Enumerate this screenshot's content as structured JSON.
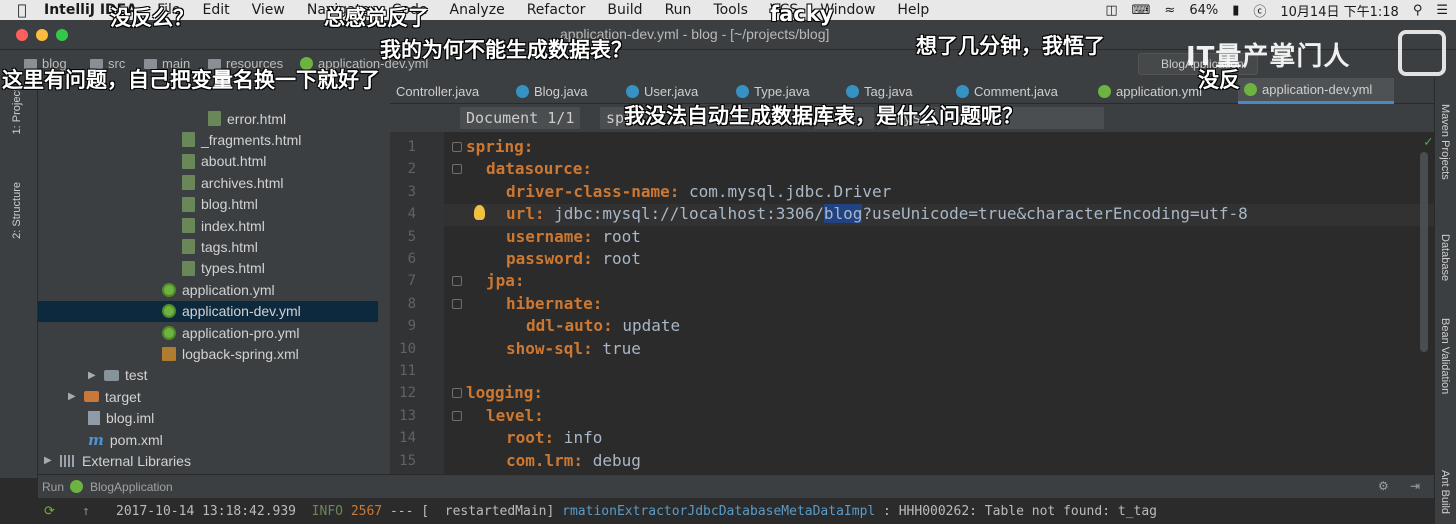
{
  "menubar": {
    "app_name": "IntelliJ IDEA",
    "items": [
      "File",
      "Edit",
      "View",
      "Navigate",
      "Code",
      "Analyze",
      "Refactor",
      "Build",
      "Run",
      "Tools",
      "VCS",
      "Window",
      "Help"
    ],
    "battery": "64%",
    "datetime": "10月14日 下午1:18"
  },
  "window": {
    "title": "application-dev.yml - blog - [~/projects/blog]",
    "colors": {
      "close": "#fc605c",
      "minimize": "#fdbc40",
      "zoom": "#34c84a"
    }
  },
  "navbar": {
    "crumbs": [
      "blog",
      "src",
      "main",
      "resources",
      "application-dev.yml"
    ],
    "run_config": "BlogApplication"
  },
  "left_strip": {
    "project_label": "1: Project",
    "structure_label": "2: Structure"
  },
  "right_strip": {
    "labels": [
      "Maven Projects",
      "Database",
      "Bean Validation",
      "Ant Build"
    ]
  },
  "project_tree": [
    {
      "name": "error.html",
      "icon": "html-file-icon"
    },
    {
      "name": "_fragments.html",
      "icon": "html-file-icon"
    },
    {
      "name": "about.html",
      "icon": "html-file-icon"
    },
    {
      "name": "archives.html",
      "icon": "html-file-icon"
    },
    {
      "name": "blog.html",
      "icon": "html-file-icon"
    },
    {
      "name": "index.html",
      "icon": "html-file-icon"
    },
    {
      "name": "tags.html",
      "icon": "html-file-icon"
    },
    {
      "name": "types.html",
      "icon": "html-file-icon"
    },
    {
      "name": "application.yml",
      "icon": "spring-yml-icon"
    },
    {
      "name": "application-dev.yml",
      "icon": "spring-yml-icon"
    },
    {
      "name": "application-pro.yml",
      "icon": "spring-yml-icon"
    },
    {
      "name": "logback-spring.xml",
      "icon": "xml-file-icon"
    },
    {
      "name": "test",
      "icon": "folder-icon"
    },
    {
      "name": "target",
      "icon": "folder-orange-icon"
    },
    {
      "name": "blog.iml",
      "icon": "iml-file-icon"
    },
    {
      "name": "pom.xml",
      "icon": "maven-icon"
    },
    {
      "name": "External Libraries",
      "icon": "library-icon"
    }
  ],
  "tabs": [
    "Controller.java",
    "Blog.java",
    "User.java",
    "Type.java",
    "Tag.java",
    "Comment.java",
    "application.yml",
    "application-dev.yml"
  ],
  "docbar": {
    "document": "Document 1/1",
    "chip2": "spr",
    "chip3": "",
    "chip4": "",
    "chip5": "mysql local"
  },
  "editor": {
    "lines": [
      {
        "n": "1",
        "key": "spring:",
        "val": ""
      },
      {
        "n": "2",
        "key": "datasource:",
        "val": ""
      },
      {
        "n": "3",
        "key": "driver-class-name:",
        "val": " com.mysql.jdbc.Driver"
      },
      {
        "n": "4",
        "key": "url:",
        "val": " jdbc:mysql://localhost:3306/"
      },
      {
        "n": "5",
        "key": "username:",
        "val": " root"
      },
      {
        "n": "6",
        "key": "password:",
        "val": " root"
      },
      {
        "n": "7",
        "key": "jpa:",
        "val": ""
      },
      {
        "n": "8",
        "key": "hibernate:",
        "val": ""
      },
      {
        "n": "9",
        "key": "ddl-auto:",
        "val": " update"
      },
      {
        "n": "10",
        "key": "show-sql:",
        "val": " true"
      },
      {
        "n": "11",
        "key": "",
        "val": ""
      },
      {
        "n": "12",
        "key": "logging:",
        "val": ""
      },
      {
        "n": "13",
        "key": "level:",
        "val": ""
      },
      {
        "n": "14",
        "key": "root:",
        "val": " info"
      },
      {
        "n": "15",
        "key": "com.lrm:",
        "val": " debug"
      }
    ],
    "url_highlight": "blog",
    "url_tail": "?useUnicode=true&characterEncoding=utf-8"
  },
  "run": {
    "label": "Run",
    "config": "BlogApplication"
  },
  "console": {
    "timestamp": "2017-10-14 13:18:42.939",
    "level": "INFO",
    "pid": "2567",
    "sep": " --- [",
    "thread": "  restartedMain]",
    "logger": "rmationExtractorJdbcDatabaseMetaDataImpl",
    "message": " : HHH000262: Table not found: t_tag"
  },
  "danmaku": [
    "没反么？",
    "总感觉反了",
    "facky",
    "我的为何不能生成数据表？",
    "想了几分钟，我悟了",
    "这里有问题，自己把变量名换一下就好了",
    "没反",
    "我没法自动生成数据库表，是什么问题呢？"
  ],
  "watermark": "IT量产掌门人"
}
